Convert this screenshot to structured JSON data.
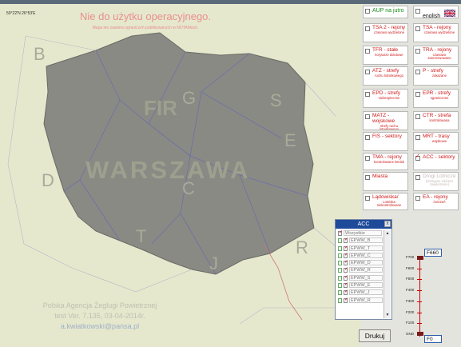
{
  "map": {
    "coords": "50°22'N 26°53'E",
    "warning_title": "Nie do użytku operacyjnego.",
    "warning_sub": "Mapa nie zawiera ograniczeń publikowanych w NOTAMach.",
    "fir_label": "FIR",
    "country_label": "WARSZAWA",
    "sector_letters": [
      "B",
      "G",
      "S",
      "E",
      "D",
      "C",
      "T",
      "J",
      "R"
    ],
    "credit_line1": "Polska Agencja Żeglugi Powietrznej",
    "credit_line2": "test Ver. 7.135,  03-04-2014r.",
    "credit_email": "a.kwiatkowski@pansa.pl"
  },
  "panel": {
    "aup_label": "AUP na jutro",
    "english_label": "english",
    "buttons": [
      {
        "t1": "TSA 2 - rejony",
        "t2": "czasowo wydzielone",
        "checked": false,
        "dim": false
      },
      {
        "t1": "TSA - rejony",
        "t2": "czasowo wydzielone",
        "checked": false,
        "dim": false
      },
      {
        "t1": "TFR - stałe",
        "t2": "korytarze dolotowe",
        "checked": false,
        "dim": false
      },
      {
        "t1": "TRA - rejony",
        "t2": "czasowo zarezerwowane",
        "checked": false,
        "dim": false
      },
      {
        "t1": "ATZ - strefy",
        "t2": "ruchu lotniskowego",
        "checked": false,
        "dim": false
      },
      {
        "t1": "P - strefy",
        "t2": "zakazane",
        "checked": false,
        "dim": false
      },
      {
        "t1": "EPD - strefy",
        "t2": "niebezpieczne",
        "checked": false,
        "dim": false
      },
      {
        "t1": "EPR - strefy",
        "t2": "ograniczone",
        "checked": false,
        "dim": false
      },
      {
        "t1": "MATZ - wojskowe",
        "t2": "strefy ruchu lotniskowego",
        "checked": false,
        "dim": false
      },
      {
        "t1": "CTR - strefa",
        "t2": "kontrolowana",
        "checked": false,
        "dim": false
      },
      {
        "t1": "FIS - sektory",
        "t2": "",
        "checked": false,
        "dim": false
      },
      {
        "t1": "MRT - trasy",
        "t2": "wojskowe",
        "checked": false,
        "dim": false
      },
      {
        "t1": "TMA - rejony",
        "t2": "kontrolowane lotnisk",
        "checked": false,
        "dim": false
      },
      {
        "t1": "ACC - sektory",
        "t2": "",
        "checked": true,
        "dim": false
      },
      {
        "t1": "Miasta",
        "t2": "",
        "checked": false,
        "dim": false
      },
      {
        "t1": "Drogi Lotnicze",
        "t2": "(dostępne wkrótce zwiększenie)",
        "checked": false,
        "dim": true
      },
      {
        "t1": "Lądowiska/",
        "t2": "Lotniska niekontrolowane",
        "checked": false,
        "dim": false
      },
      {
        "t1": "EA - rejony",
        "t2": "ćwiczeń",
        "checked": false,
        "dim": false
      }
    ]
  },
  "acc": {
    "title": "ACC",
    "close": "x",
    "items": [
      "Wszystkie",
      "EPWW_B",
      "EPWW_T",
      "EPWW_C",
      "EPWW_D",
      "EPWW_R",
      "EPWW_S",
      "EPWW_E",
      "EPWW_J",
      "EPWW_R"
    ]
  },
  "print_button": "Drukuj",
  "altitude": {
    "upper": "F660",
    "lower": "F0",
    "levels": [
      "F700",
      "F600",
      "F500",
      "F400",
      "F300",
      "F200",
      "F100",
      "GND"
    ]
  }
}
